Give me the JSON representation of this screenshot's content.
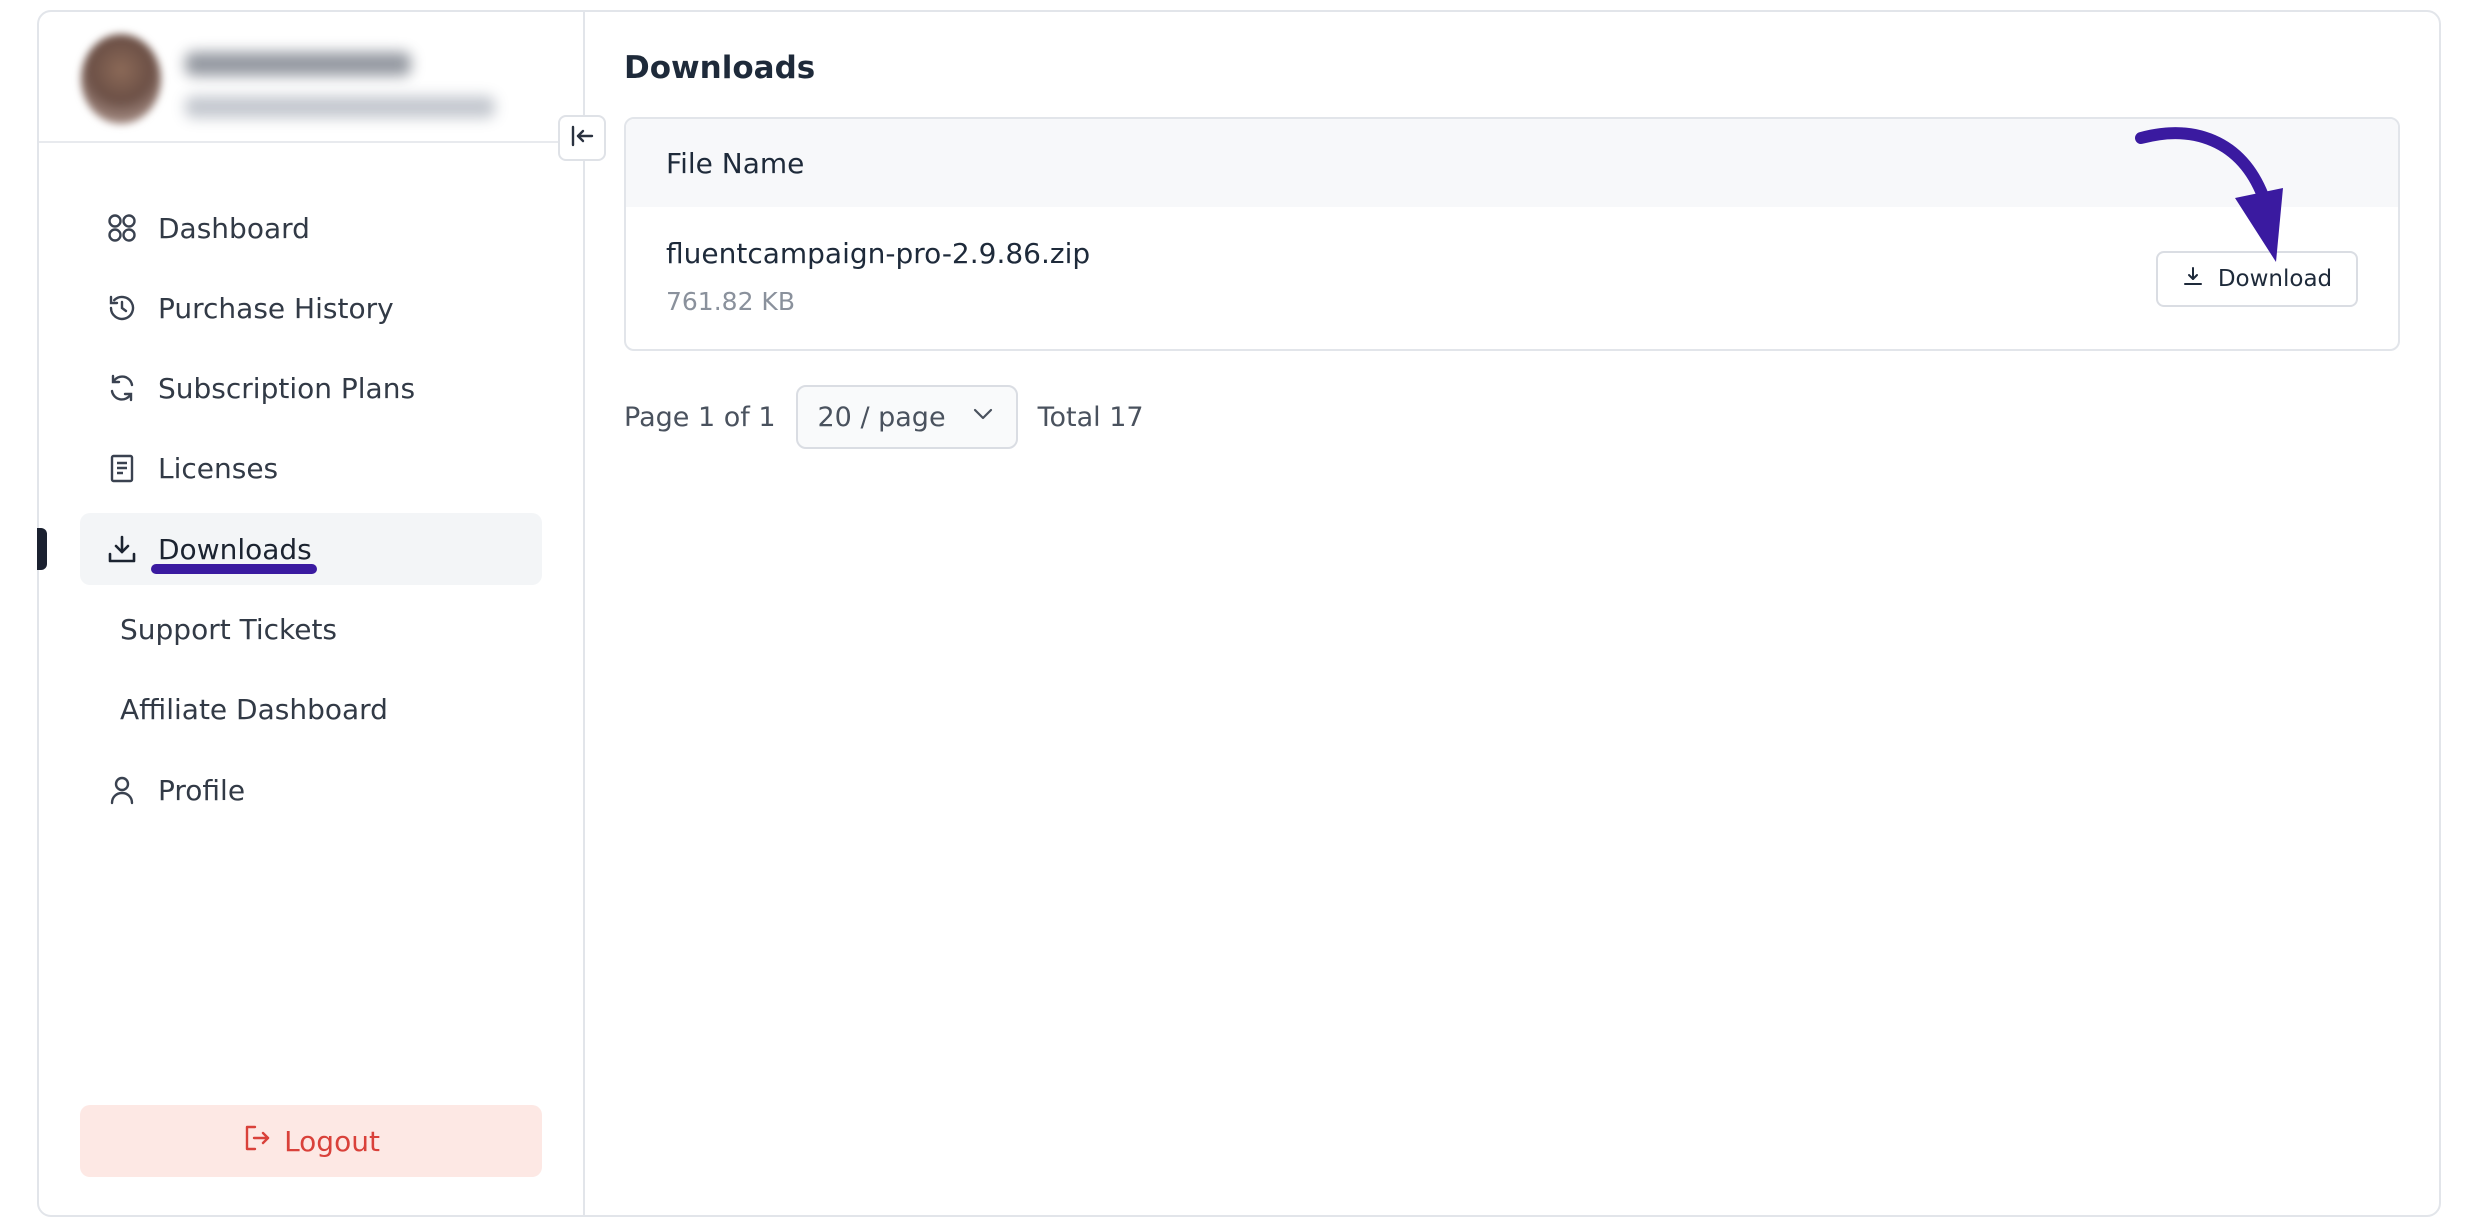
{
  "sidebar": {
    "items": [
      {
        "label": "Dashboard",
        "icon": "grid-icon"
      },
      {
        "label": "Purchase History",
        "icon": "history-icon"
      },
      {
        "label": "Subscription Plans",
        "icon": "refresh-icon"
      },
      {
        "label": "Licenses",
        "icon": "document-icon"
      },
      {
        "label": "Downloads",
        "icon": "download-tray-icon",
        "active": true
      },
      {
        "label": "Support Tickets"
      },
      {
        "label": "Affiliate Dashboard"
      },
      {
        "label": "Profile",
        "icon": "user-icon"
      }
    ],
    "logout_label": "Logout"
  },
  "main": {
    "title": "Downloads",
    "table": {
      "header": "File Name",
      "rows": [
        {
          "file_name": "fluentcampaign-pro-2.9.86.zip",
          "size": "761.82 KB",
          "action_label": "Download"
        }
      ]
    },
    "pagination": {
      "page_text": "Page 1 of 1",
      "page_size": "20 / page",
      "total": "Total 17"
    }
  },
  "colors": {
    "accent_annotation": "#3a1aa0",
    "logout_bg": "#fde8e4",
    "logout_text": "#d9413a",
    "active_bg": "#f3f5f7"
  }
}
